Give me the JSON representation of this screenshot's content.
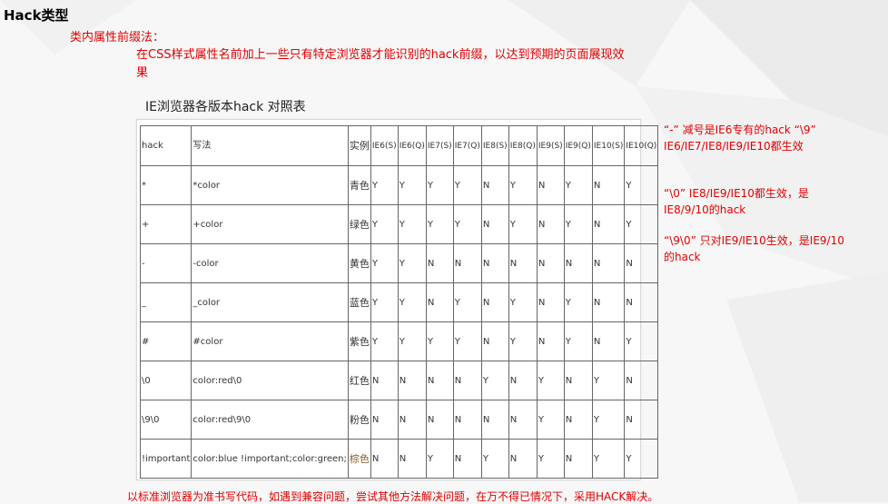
{
  "heading": "Hack类型",
  "subtitle": "类内属性前缀法：",
  "description": "在CSS样式属性名前加上一些只有特定浏览器才能识别的hack前缀，以达到预期的页面展现效果",
  "table_title": "IE浏览器各版本hack 对照表",
  "table": {
    "headers": [
      "hack",
      "写法",
      "实例",
      "IE6(S)",
      "IE6(Q)",
      "IE7(S)",
      "IE7(Q)",
      "IE8(S)",
      "IE8(Q)",
      "IE9(S)",
      "IE9(Q)",
      "IE10(S)",
      "IE10(Q)"
    ],
    "rows": [
      {
        "hack": "*",
        "write": "*color",
        "color": "青色",
        "values": [
          "Y",
          "Y",
          "Y",
          "Y",
          "N",
          "Y",
          "N",
          "Y",
          "N",
          "Y"
        ]
      },
      {
        "hack": "+",
        "write": "+color",
        "color": "绿色",
        "values": [
          "Y",
          "Y",
          "Y",
          "Y",
          "N",
          "Y",
          "N",
          "Y",
          "N",
          "Y"
        ]
      },
      {
        "hack": "-",
        "write": "-color",
        "color": "黄色",
        "values": [
          "Y",
          "Y",
          "N",
          "N",
          "N",
          "N",
          "N",
          "N",
          "N",
          "N"
        ]
      },
      {
        "hack": "_",
        "write": "_color",
        "color": "蓝色",
        "values": [
          "Y",
          "Y",
          "N",
          "Y",
          "N",
          "Y",
          "N",
          "Y",
          "N",
          "N"
        ]
      },
      {
        "hack": "#",
        "write": "#color",
        "color": "紫色",
        "values": [
          "Y",
          "Y",
          "Y",
          "Y",
          "N",
          "Y",
          "N",
          "Y",
          "N",
          "Y"
        ]
      },
      {
        "hack": "\\0",
        "write": "color:red\\0",
        "color": "红色",
        "values": [
          "N",
          "N",
          "N",
          "N",
          "Y",
          "N",
          "Y",
          "N",
          "Y",
          "N"
        ]
      },
      {
        "hack": "\\9\\0",
        "write": "color:red\\9\\0",
        "color": "粉色",
        "values": [
          "N",
          "N",
          "N",
          "N",
          "N",
          "N",
          "Y",
          "N",
          "Y",
          "N"
        ]
      },
      {
        "hack": "!important",
        "write": "color:blue !important;color:green;",
        "color": "棕色",
        "values": [
          "N",
          "N",
          "Y",
          "N",
          "Y",
          "N",
          "Y",
          "N",
          "Y",
          "Y"
        ]
      }
    ]
  },
  "notes": [
    "“-” 减号是IE6专有的hack “\\9”  IE6/IE7/IE8/IE9/IE10都生效",
    "“\\0”  IE8/IE9/IE10都生效，是IE8/9/10的hack",
    "“\\9\\0” 只对IE9/IE10生效，是IE9/10的hack"
  ],
  "footer": "以标准浏览器为准书写代码，如遇到兼容问题，尝试其他方法解决问题，在万不得已情况下，采用HACK解决。",
  "colors": {
    "accent_red": "#e00000",
    "brown_text": "#8b5a2b",
    "background": "#f7f7f7"
  }
}
